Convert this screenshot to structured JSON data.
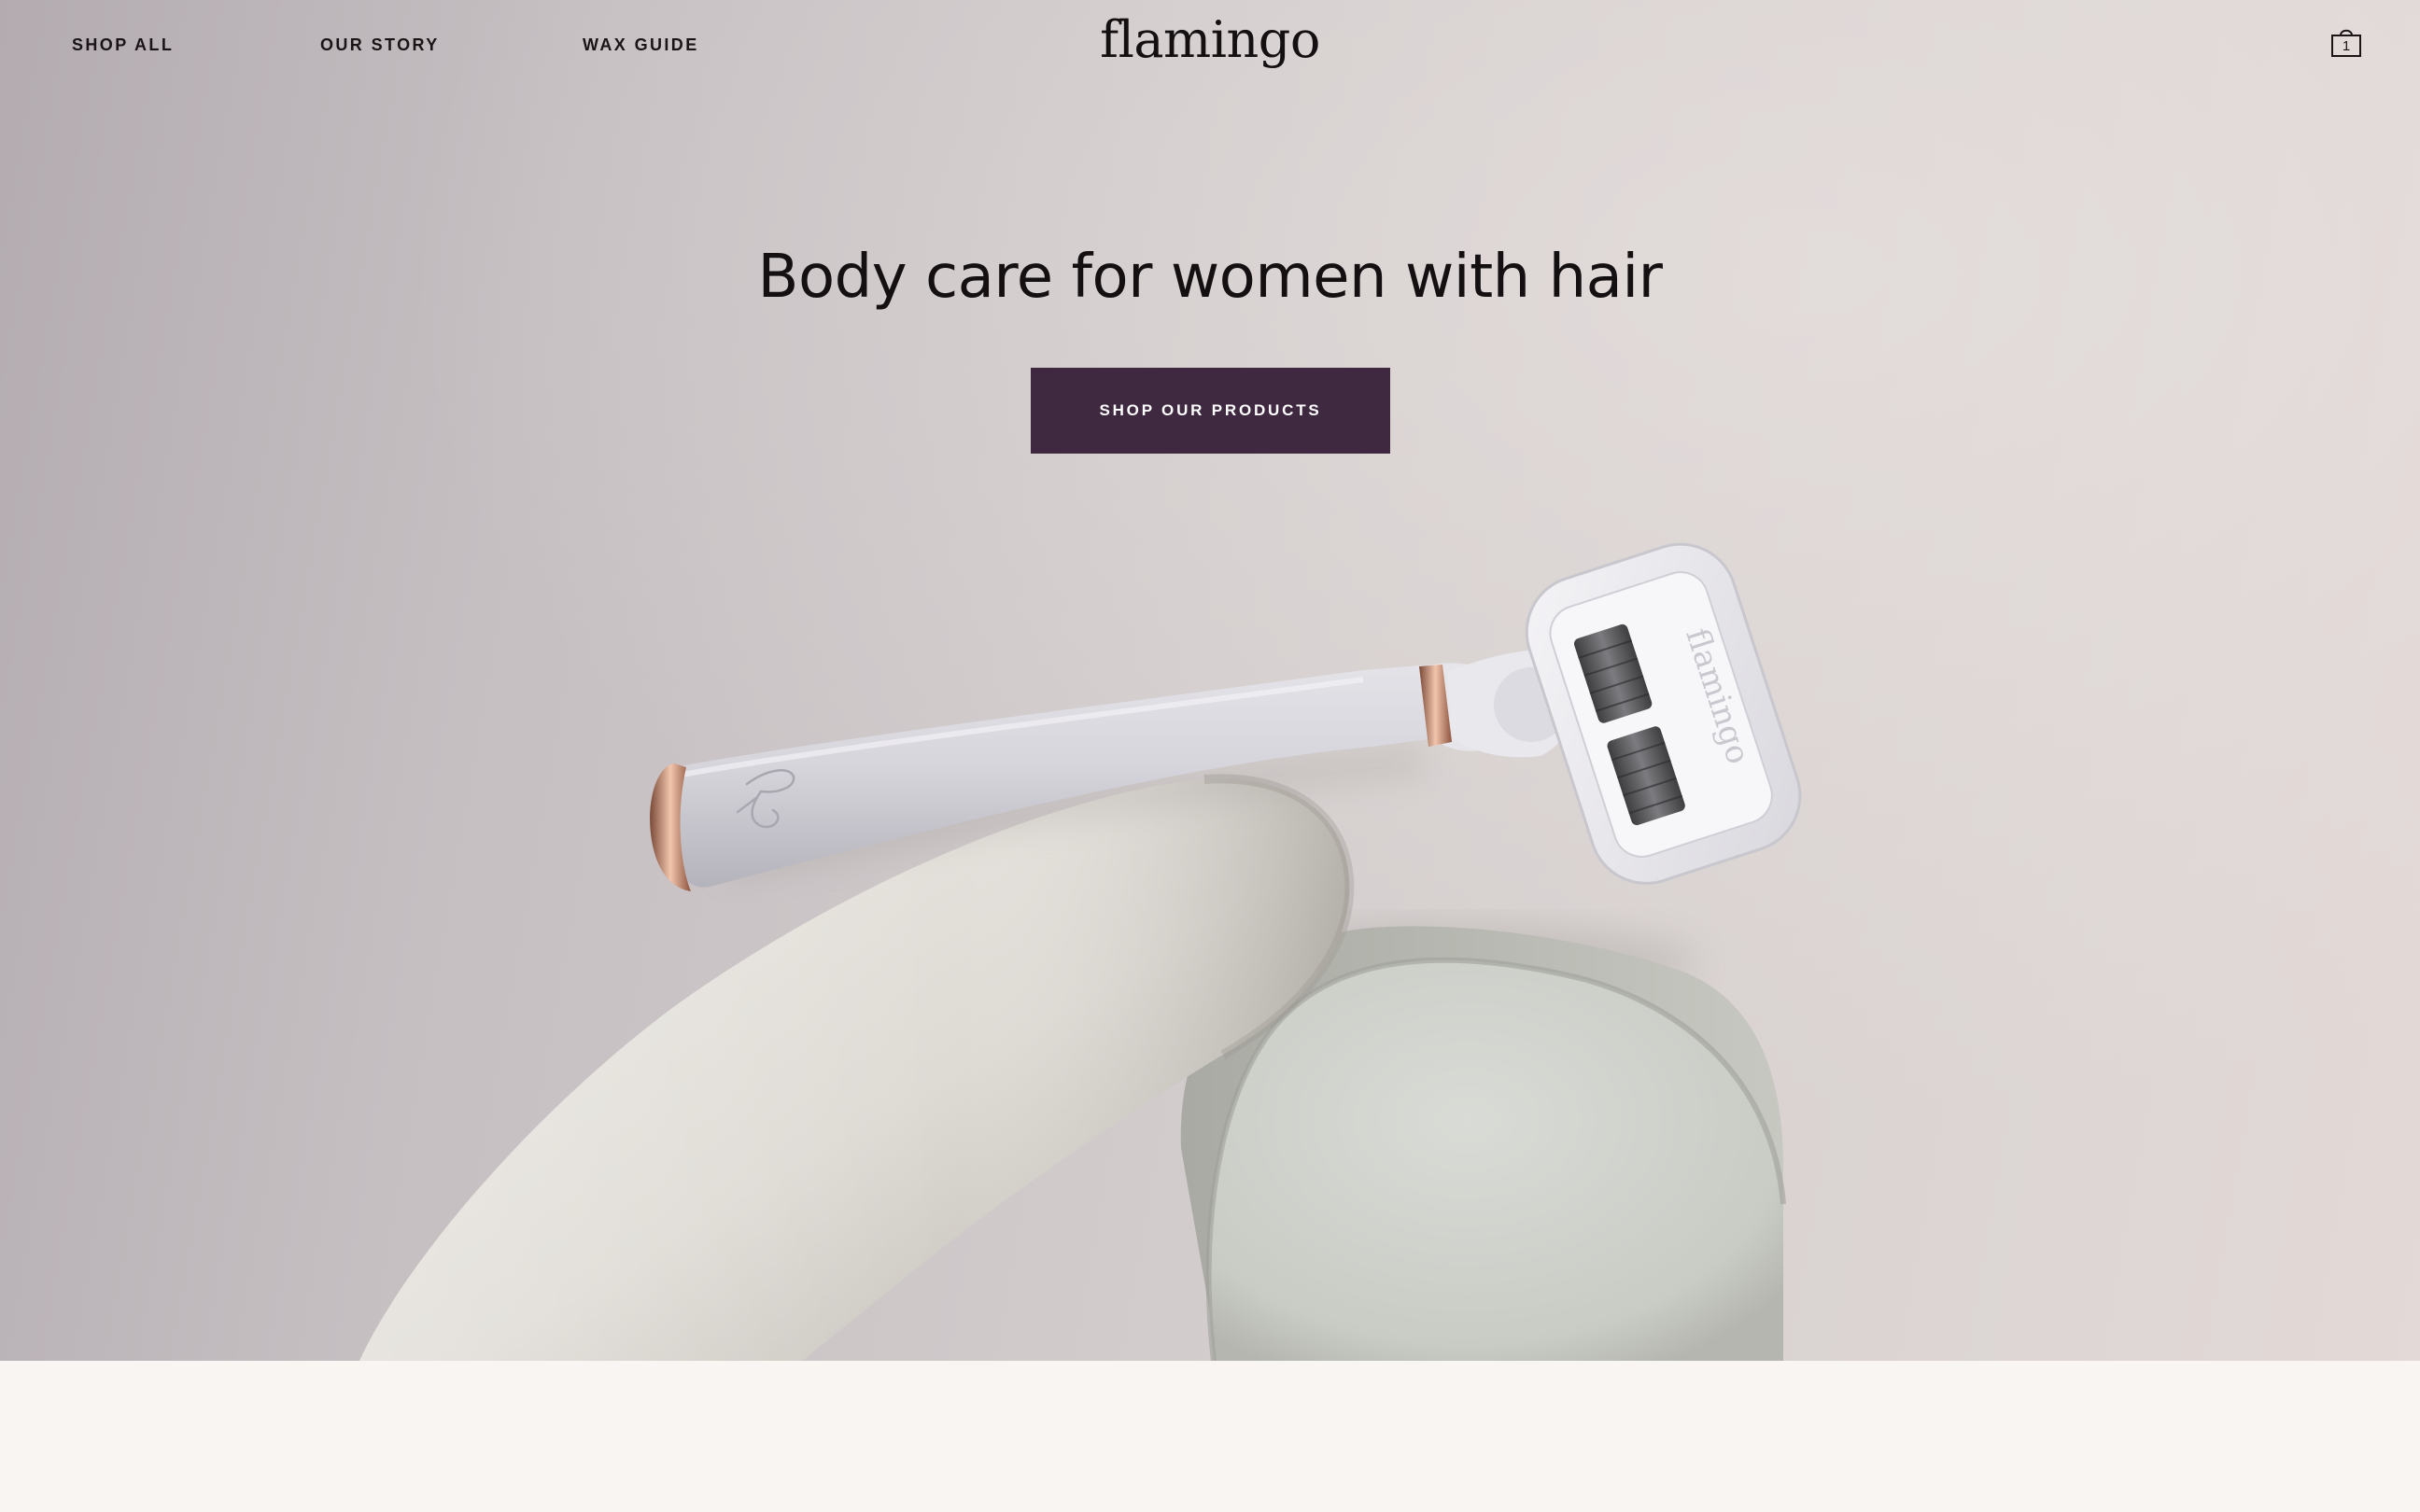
{
  "header": {
    "nav": [
      {
        "label": "SHOP ALL"
      },
      {
        "label": "OUR STORY"
      },
      {
        "label": "WAX GUIDE"
      }
    ],
    "logo": "flamingo",
    "cart": {
      "icon": "shopping-bag-icon",
      "count": "1"
    }
  },
  "hero": {
    "headline": "Body care for women with hair",
    "cta_label": "SHOP OUR PRODUCTS",
    "razor_brand": "flamingo",
    "colors": {
      "cta_background": "#3f2940",
      "cta_text": "#ffffff",
      "background": "#d3cdcd"
    }
  },
  "footer_band": {
    "color": "#f8f5f2"
  }
}
